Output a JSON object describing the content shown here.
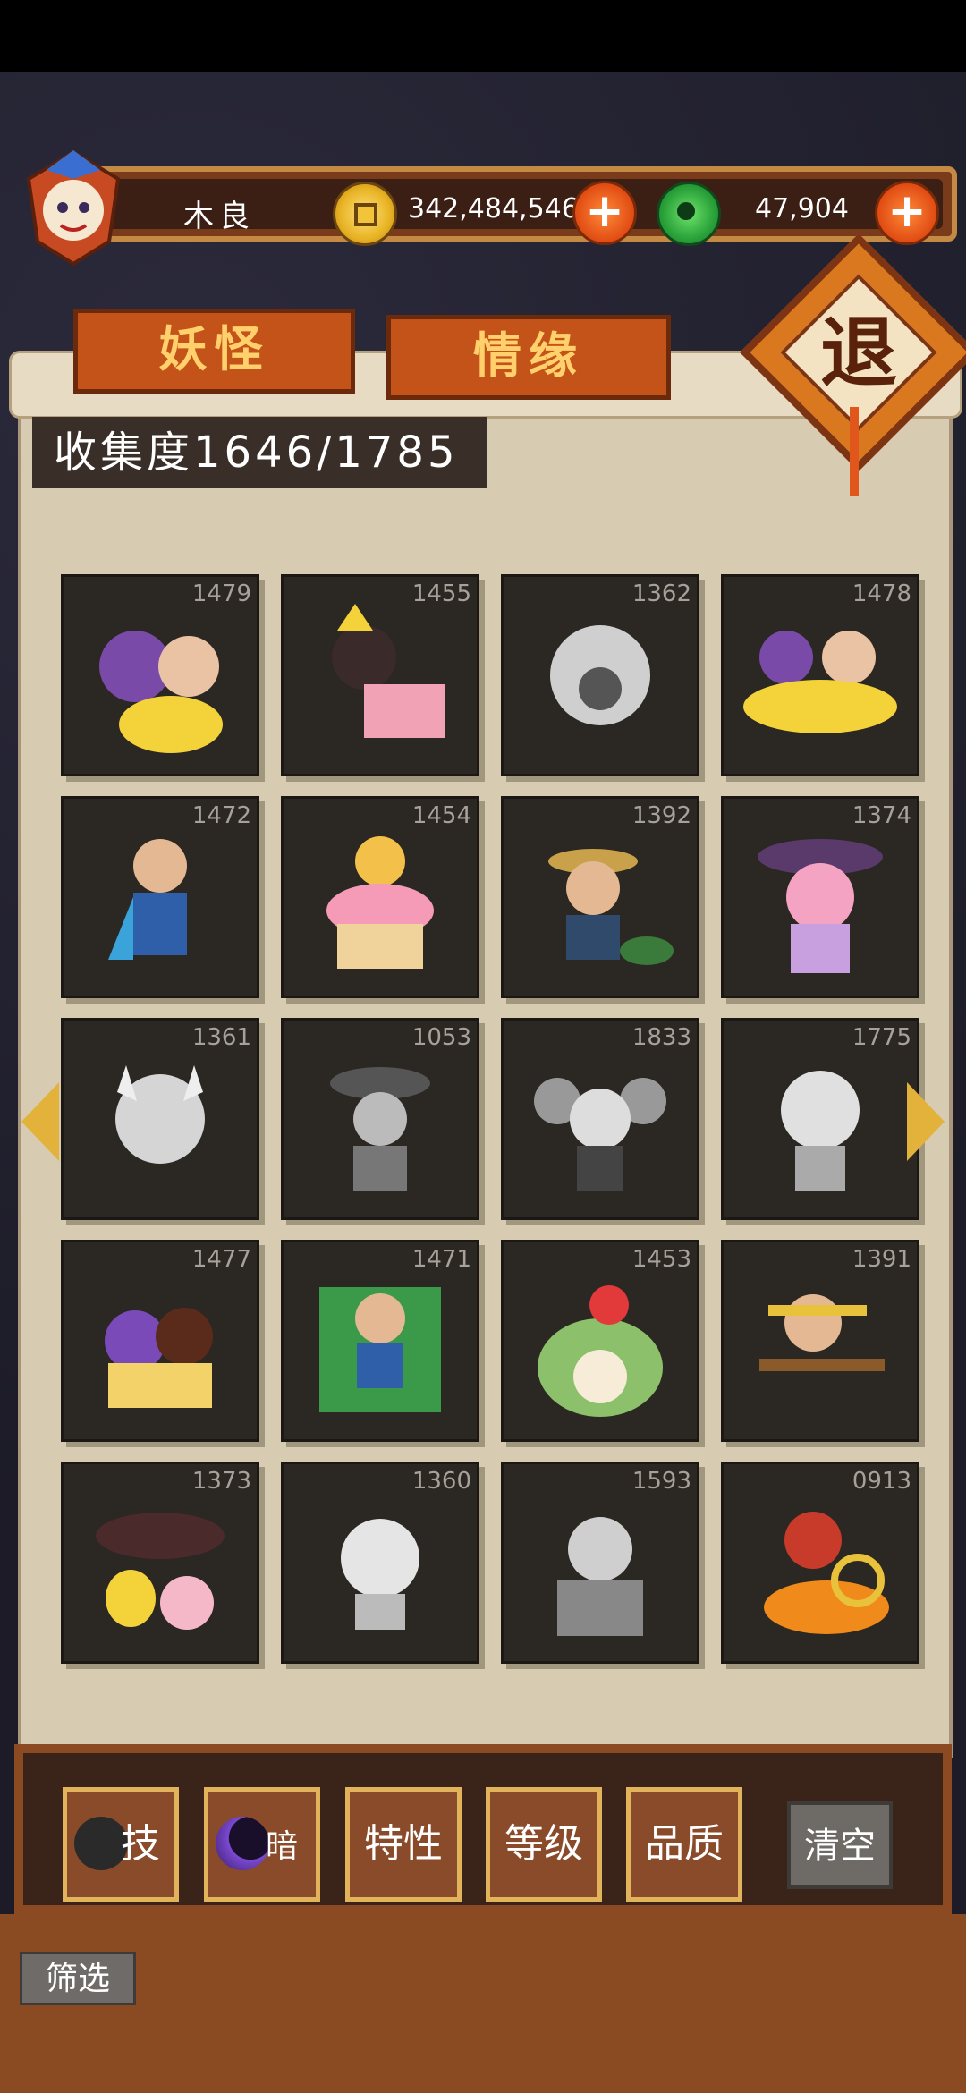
{
  "player": {
    "name": "木良"
  },
  "currency": {
    "gold": "342,484,546",
    "jade": "47,904"
  },
  "tabs": [
    {
      "label": "妖怪"
    },
    {
      "label": "情缘"
    }
  ],
  "exit_label": "退",
  "collection": {
    "text": "收集度1646/1785"
  },
  "cards": [
    {
      "num": "1479"
    },
    {
      "num": "1455"
    },
    {
      "num": "1362"
    },
    {
      "num": "1478"
    },
    {
      "num": "1472"
    },
    {
      "num": "1454"
    },
    {
      "num": "1392"
    },
    {
      "num": "1374"
    },
    {
      "num": "1361"
    },
    {
      "num": "1053"
    },
    {
      "num": "1833"
    },
    {
      "num": "1775"
    },
    {
      "num": "1477"
    },
    {
      "num": "1471"
    },
    {
      "num": "1453"
    },
    {
      "num": "1391"
    },
    {
      "num": "1373"
    },
    {
      "num": "1360"
    },
    {
      "num": "1593"
    },
    {
      "num": "0913"
    }
  ],
  "filters": [
    {
      "label": "技"
    },
    {
      "label": "暗"
    },
    {
      "label": "特性"
    },
    {
      "label": "等级"
    },
    {
      "label": "品质"
    }
  ],
  "clear_label": "清空",
  "filter_label": "筛选",
  "colors": {
    "wood": "#8a4a22",
    "tab": "#c4531a",
    "parchment": "#d7ccb2",
    "gold_text": "#ffd06b"
  }
}
